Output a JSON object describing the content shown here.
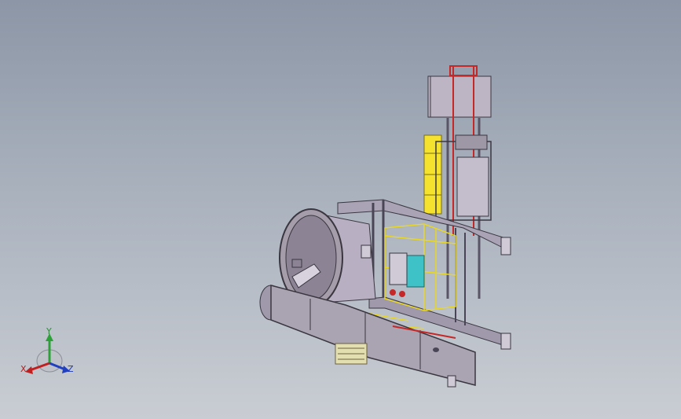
{
  "viewport": {
    "background_top": "#8c96a6",
    "background_bottom": "#c9cdd3"
  },
  "triad": {
    "x_label": "X",
    "y_label": "Y",
    "z_label": "Z",
    "x_color": "#c02020",
    "y_color": "#2ea03a",
    "z_color": "#2040c0"
  },
  "model": {
    "description_icon": "assembly-model-icon"
  }
}
